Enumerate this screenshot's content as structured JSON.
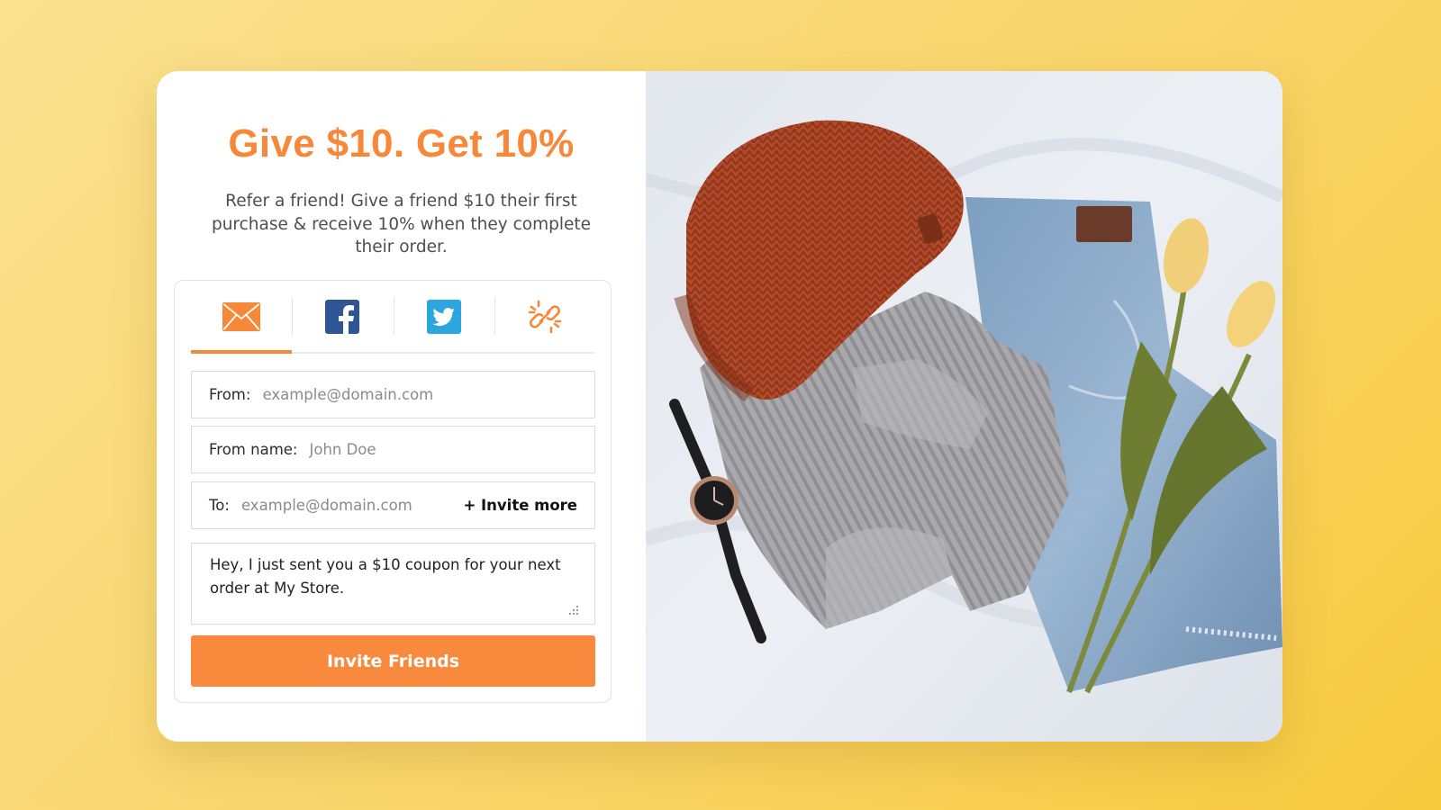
{
  "hero": {
    "title": "Give $10. Get 10%",
    "subtitle": "Refer a friend! Give a friend $10 their first purchase & receive 10% when they complete their order."
  },
  "share_tabs": [
    {
      "id": "email",
      "icon": "envelope-icon",
      "color": "#f7883a",
      "active": true
    },
    {
      "id": "facebook",
      "icon": "facebook-icon",
      "color": "#2f5597",
      "active": false
    },
    {
      "id": "twitter",
      "icon": "twitter-icon",
      "color": "#2ba6df",
      "active": false
    },
    {
      "id": "link",
      "icon": "link-icon",
      "color": "#f7883a",
      "active": false
    }
  ],
  "form": {
    "from_label": "From:",
    "from_placeholder": "example@domain.com",
    "from_name_label": "From name:",
    "from_name_placeholder": "John Doe",
    "to_label": "To:",
    "to_placeholder": "example@domain.com",
    "invite_more": "+ Invite more",
    "message": "Hey, I just sent you a $10 coupon for your next order at My Store.",
    "submit_label": "Invite Friends"
  },
  "colors": {
    "accent": "#f7883a",
    "button": "#f98a3d",
    "background": "#f9d56a"
  }
}
